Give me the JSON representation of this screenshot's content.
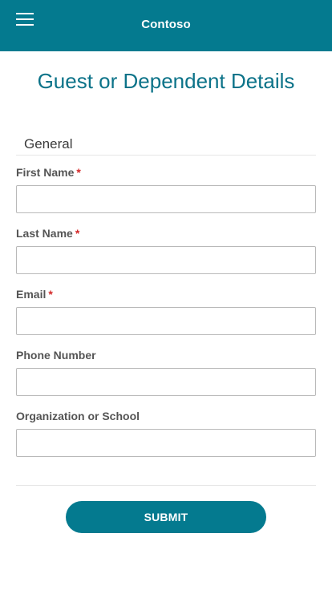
{
  "header": {
    "brand": "Contoso",
    "menu_icon": "hamburger-menu-icon",
    "background_color": "#047a8f"
  },
  "page": {
    "title": "Guest or Dependent Details"
  },
  "section": {
    "title": "General"
  },
  "fields": [
    {
      "label": "First Name",
      "required_mark": "*",
      "value": ""
    },
    {
      "label": "Last Name",
      "required_mark": "*",
      "value": ""
    },
    {
      "label": "Email",
      "required_mark": "*",
      "value": ""
    },
    {
      "label": "Phone Number",
      "required_mark": "",
      "value": ""
    },
    {
      "label": "Organization or School",
      "required_mark": "",
      "value": ""
    }
  ],
  "submit": {
    "label": "SUBMIT"
  },
  "colors": {
    "accent": "#047a8f",
    "title": "#0c7389",
    "required": "#d42a2a"
  }
}
